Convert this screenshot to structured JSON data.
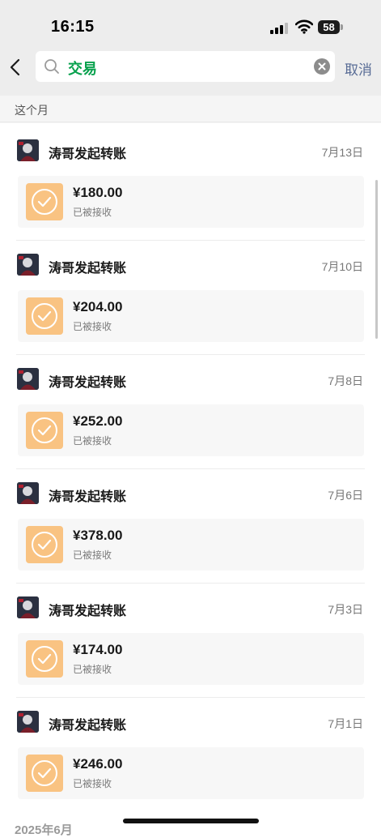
{
  "status_bar": {
    "time": "16:15",
    "battery": "58"
  },
  "search": {
    "query": "交易",
    "cancel_label": "取消"
  },
  "month_header": "这个月",
  "transfers": [
    {
      "sender": "涛哥发起转账",
      "date": "7月13日",
      "amount": "¥180.00",
      "status": "已被接收"
    },
    {
      "sender": "涛哥发起转账",
      "date": "7月10日",
      "amount": "¥204.00",
      "status": "已被接收"
    },
    {
      "sender": "涛哥发起转账",
      "date": "7月8日",
      "amount": "¥252.00",
      "status": "已被接收"
    },
    {
      "sender": "涛哥发起转账",
      "date": "7月6日",
      "amount": "¥378.00",
      "status": "已被接收"
    },
    {
      "sender": "涛哥发起转账",
      "date": "7月3日",
      "amount": "¥174.00",
      "status": "已被接收"
    },
    {
      "sender": "涛哥发起转账",
      "date": "7月1日",
      "amount": "¥246.00",
      "status": "已被接收"
    }
  ],
  "next_month_header": "2025年6月",
  "colors": {
    "search_text": "#07a14d",
    "cancel": "#576b95",
    "check_tile": "#f9c382"
  },
  "icons": {
    "back": "chevron-left-icon",
    "search": "search-icon",
    "clear": "clear-icon",
    "transfer": "check-circle-icon"
  }
}
